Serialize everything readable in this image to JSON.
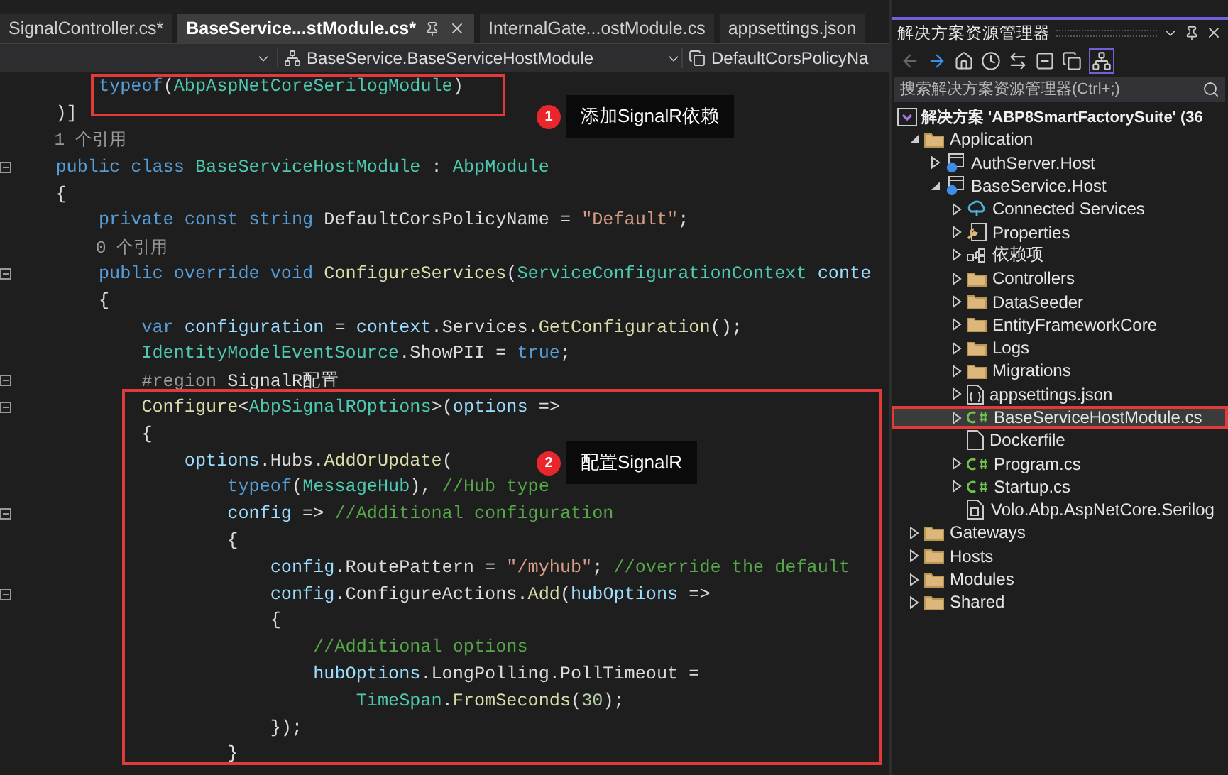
{
  "tabs": [
    {
      "label": "SignalController.cs*",
      "selected": false
    },
    {
      "label": "BaseService...stModule.cs*",
      "selected": true
    },
    {
      "label": "InternalGate...ostModule.cs",
      "selected": false
    },
    {
      "label": "appsettings.json",
      "selected": false
    }
  ],
  "nav_bar": {
    "type_dropdown": "BaseService.BaseServiceHostModule",
    "member_dropdown": "DefaultCorsPolicyNa"
  },
  "code_lines": [
    {
      "fold": false,
      "tokens": [
        {
          "kind": "kw",
          "text": "        typeof"
        },
        {
          "kind": "plain",
          "text": "("
        },
        {
          "kind": "type",
          "text": "AbpAspNetCoreSerilogModule"
        },
        {
          "kind": "plain",
          "text": ")"
        }
      ]
    },
    {
      "fold": false,
      "tokens": [
        {
          "kind": "plain",
          "text": "    )]"
        }
      ]
    },
    {
      "fold": false,
      "tokens": [
        {
          "kind": "lens",
          "text": "    1 个引用"
        }
      ]
    },
    {
      "fold": true,
      "tokens": [
        {
          "kind": "kw",
          "text": "    public class "
        },
        {
          "kind": "type",
          "text": "BaseServiceHostModule"
        },
        {
          "kind": "plain",
          "text": " : "
        },
        {
          "kind": "type",
          "text": "AbpModule"
        }
      ]
    },
    {
      "fold": false,
      "tokens": [
        {
          "kind": "plain",
          "text": "    {"
        }
      ]
    },
    {
      "fold": false,
      "tokens": [
        {
          "kind": "kw",
          "text": "        private const string"
        },
        {
          "kind": "plain",
          "text": " DefaultCorsPolicyName = "
        },
        {
          "kind": "str",
          "text": "\"Default\""
        },
        {
          "kind": "plain",
          "text": ";"
        }
      ]
    },
    {
      "fold": false,
      "tokens": [
        {
          "kind": "lens",
          "text": "        0 个引用"
        }
      ]
    },
    {
      "fold": true,
      "tokens": [
        {
          "kind": "kw",
          "text": "        public override void "
        },
        {
          "kind": "method",
          "text": "ConfigureServices"
        },
        {
          "kind": "plain",
          "text": "("
        },
        {
          "kind": "type",
          "text": "ServiceConfigurationContext"
        },
        {
          "kind": "param",
          "text": " conte"
        }
      ]
    },
    {
      "fold": false,
      "tokens": [
        {
          "kind": "plain",
          "text": "        {"
        }
      ]
    },
    {
      "fold": false,
      "tokens": [
        {
          "kind": "kw",
          "text": "            var"
        },
        {
          "kind": "param",
          "text": " configuration"
        },
        {
          "kind": "plain",
          "text": " = "
        },
        {
          "kind": "param",
          "text": "context"
        },
        {
          "kind": "plain",
          "text": ".Services."
        },
        {
          "kind": "method",
          "text": "GetConfiguration"
        },
        {
          "kind": "plain",
          "text": "();"
        }
      ]
    },
    {
      "fold": false,
      "tokens": [
        {
          "kind": "type",
          "text": "            IdentityModelEventSource"
        },
        {
          "kind": "plain",
          "text": ".ShowPII = "
        },
        {
          "kind": "kw",
          "text": "true"
        },
        {
          "kind": "plain",
          "text": ";"
        }
      ]
    },
    {
      "fold": true,
      "tokens": [
        {
          "kind": "preproc",
          "text": "            #region"
        },
        {
          "kind": "plain",
          "text": " SignalR配置"
        }
      ]
    },
    {
      "fold": true,
      "tokens": [
        {
          "kind": "method",
          "text": "            Configure"
        },
        {
          "kind": "plain",
          "text": "<"
        },
        {
          "kind": "type",
          "text": "AbpSignalROptions"
        },
        {
          "kind": "plain",
          "text": ">("
        },
        {
          "kind": "param",
          "text": "options"
        },
        {
          "kind": "plain",
          "text": " =>"
        }
      ]
    },
    {
      "fold": false,
      "tokens": [
        {
          "kind": "plain",
          "text": "            {"
        }
      ]
    },
    {
      "fold": false,
      "tokens": [
        {
          "kind": "param",
          "text": "                options"
        },
        {
          "kind": "plain",
          "text": ".Hubs."
        },
        {
          "kind": "method",
          "text": "AddOrUpdate"
        },
        {
          "kind": "plain",
          "text": "("
        }
      ]
    },
    {
      "fold": false,
      "tokens": [
        {
          "kind": "kw",
          "text": "                    typeof"
        },
        {
          "kind": "plain",
          "text": "("
        },
        {
          "kind": "type",
          "text": "MessageHub"
        },
        {
          "kind": "plain",
          "text": "), "
        },
        {
          "kind": "comment",
          "text": "//Hub type"
        }
      ]
    },
    {
      "fold": true,
      "tokens": [
        {
          "kind": "param",
          "text": "                    config"
        },
        {
          "kind": "plain",
          "text": " => "
        },
        {
          "kind": "comment",
          "text": "//Additional configuration"
        }
      ]
    },
    {
      "fold": false,
      "tokens": [
        {
          "kind": "plain",
          "text": "                    {"
        }
      ]
    },
    {
      "fold": false,
      "tokens": [
        {
          "kind": "param",
          "text": "                        config"
        },
        {
          "kind": "plain",
          "text": ".RoutePattern = "
        },
        {
          "kind": "str",
          "text": "\"/myhub\""
        },
        {
          "kind": "plain",
          "text": "; "
        },
        {
          "kind": "comment",
          "text": "//override the default"
        }
      ]
    },
    {
      "fold": true,
      "tokens": [
        {
          "kind": "param",
          "text": "                        config"
        },
        {
          "kind": "plain",
          "text": ".ConfigureActions."
        },
        {
          "kind": "method",
          "text": "Add"
        },
        {
          "kind": "plain",
          "text": "("
        },
        {
          "kind": "param",
          "text": "hubOptions"
        },
        {
          "kind": "plain",
          "text": " =>"
        }
      ]
    },
    {
      "fold": false,
      "tokens": [
        {
          "kind": "plain",
          "text": "                        {"
        }
      ]
    },
    {
      "fold": false,
      "tokens": [
        {
          "kind": "comment",
          "text": "                            //Additional options"
        }
      ]
    },
    {
      "fold": false,
      "tokens": [
        {
          "kind": "param",
          "text": "                            hubOptions"
        },
        {
          "kind": "plain",
          "text": ".LongPolling.PollTimeout ="
        }
      ]
    },
    {
      "fold": false,
      "tokens": [
        {
          "kind": "type",
          "text": "                                TimeSpan"
        },
        {
          "kind": "plain",
          "text": "."
        },
        {
          "kind": "method",
          "text": "FromSeconds"
        },
        {
          "kind": "plain",
          "text": "("
        },
        {
          "kind": "number",
          "text": "30"
        },
        {
          "kind": "plain",
          "text": ");"
        }
      ]
    },
    {
      "fold": false,
      "tokens": [
        {
          "kind": "plain",
          "text": "                        });"
        }
      ]
    },
    {
      "fold": false,
      "tokens": [
        {
          "kind": "plain",
          "text": "                    }"
        }
      ]
    }
  ],
  "annotations": [
    {
      "number": "1",
      "text": "添加SignalR依赖"
    },
    {
      "number": "2",
      "text": "配置SignalR"
    }
  ],
  "solution_explorer": {
    "title": "解决方案资源管理器",
    "search": {
      "placeholder": "搜索解决方案资源管理器(Ctrl+;)"
    },
    "solution": "解决方案 'ABP8SmartFactorySuite' (36",
    "tree": [
      {
        "kind": "folder",
        "label": "Application",
        "expanded": true,
        "selected": false,
        "annotated": false,
        "children": [
          {
            "kind": "project",
            "label": "AuthServer.Host",
            "expanded": false,
            "selected": false,
            "annotated": false
          },
          {
            "kind": "project",
            "label": "BaseService.Host",
            "expanded": true,
            "selected": false,
            "annotated": false,
            "children": [
              {
                "kind": "connected",
                "label": "Connected Services",
                "expanded": false,
                "selected": false,
                "annotated": false
              },
              {
                "kind": "properties",
                "label": "Properties",
                "expanded": false,
                "selected": false,
                "annotated": false
              },
              {
                "kind": "deps",
                "label": "依赖项",
                "expanded": false,
                "selected": false,
                "annotated": false
              },
              {
                "kind": "folder",
                "label": "Controllers",
                "expanded": false,
                "selected": false,
                "annotated": false
              },
              {
                "kind": "folder",
                "label": "DataSeeder",
                "expanded": false,
                "selected": false,
                "annotated": false
              },
              {
                "kind": "folder",
                "label": "EntityFrameworkCore",
                "expanded": false,
                "selected": false,
                "annotated": false
              },
              {
                "kind": "folder",
                "label": "Logs",
                "expanded": false,
                "selected": false,
                "annotated": false
              },
              {
                "kind": "folder",
                "label": "Migrations",
                "expanded": false,
                "selected": false,
                "annotated": false
              },
              {
                "kind": "json",
                "label": "appsettings.json",
                "expanded": false,
                "selected": false,
                "annotated": false
              },
              {
                "kind": "cs",
                "label": "BaseServiceHostModule.cs",
                "expanded": false,
                "selected": true,
                "annotated": true
              },
              {
                "kind": "file",
                "label": "Dockerfile",
                "selected": false,
                "annotated": false
              },
              {
                "kind": "cs",
                "label": "Program.cs",
                "expanded": false,
                "selected": false,
                "annotated": false
              },
              {
                "kind": "cs",
                "label": "Startup.cs",
                "expanded": false,
                "selected": false,
                "annotated": false
              },
              {
                "kind": "ref",
                "label": "Volo.Abp.AspNetCore.Serilog",
                "selected": false,
                "annotated": false
              }
            ]
          }
        ]
      },
      {
        "kind": "folder",
        "label": "Gateways",
        "expanded": false,
        "selected": false,
        "annotated": false
      },
      {
        "kind": "folder",
        "label": "Hosts",
        "expanded": false,
        "selected": false,
        "annotated": false
      },
      {
        "kind": "folder",
        "label": "Modules",
        "expanded": false,
        "selected": false,
        "annotated": false
      },
      {
        "kind": "folder",
        "label": "Shared",
        "expanded": false,
        "selected": false,
        "annotated": false
      }
    ]
  }
}
